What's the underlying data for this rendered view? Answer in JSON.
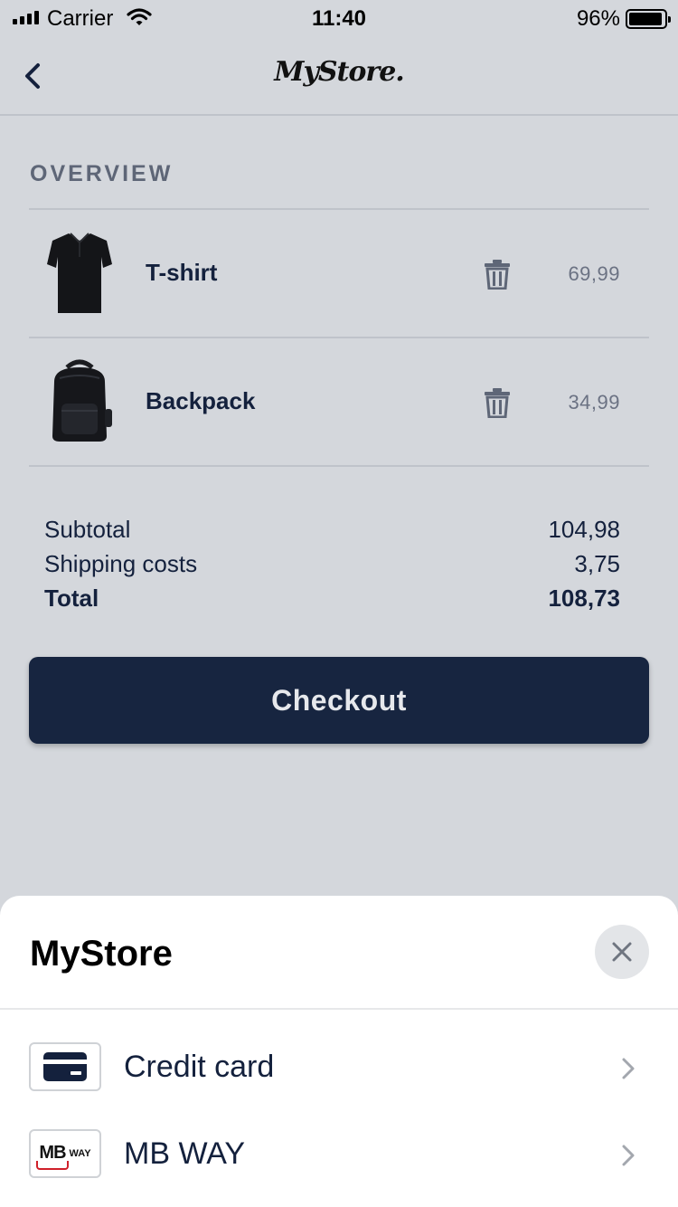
{
  "status_bar": {
    "carrier": "Carrier",
    "time": "11:40",
    "battery_percent": "96%",
    "battery_level": 0.96
  },
  "nav": {
    "logo": "MyStore."
  },
  "overview": {
    "title": "OVERVIEW",
    "items": [
      {
        "name": "T-shirt",
        "price": "69,99",
        "icon": "tshirt-icon"
      },
      {
        "name": "Backpack",
        "price": "34,99",
        "icon": "backpack-icon"
      }
    ]
  },
  "totals": {
    "subtotal_label": "Subtotal",
    "subtotal_value": "104,98",
    "shipping_label": "Shipping costs",
    "shipping_value": "3,75",
    "total_label": "Total",
    "total_value": "108,73"
  },
  "checkout": {
    "label": "Checkout",
    "color": "#172540"
  },
  "payment_sheet": {
    "title": "MyStore",
    "methods": [
      {
        "label": "Credit card",
        "icon": "credit-card-icon"
      },
      {
        "label": "MB WAY",
        "icon": "mbway-logo",
        "logo_mb": "MB",
        "logo_way": "WAY"
      }
    ]
  }
}
